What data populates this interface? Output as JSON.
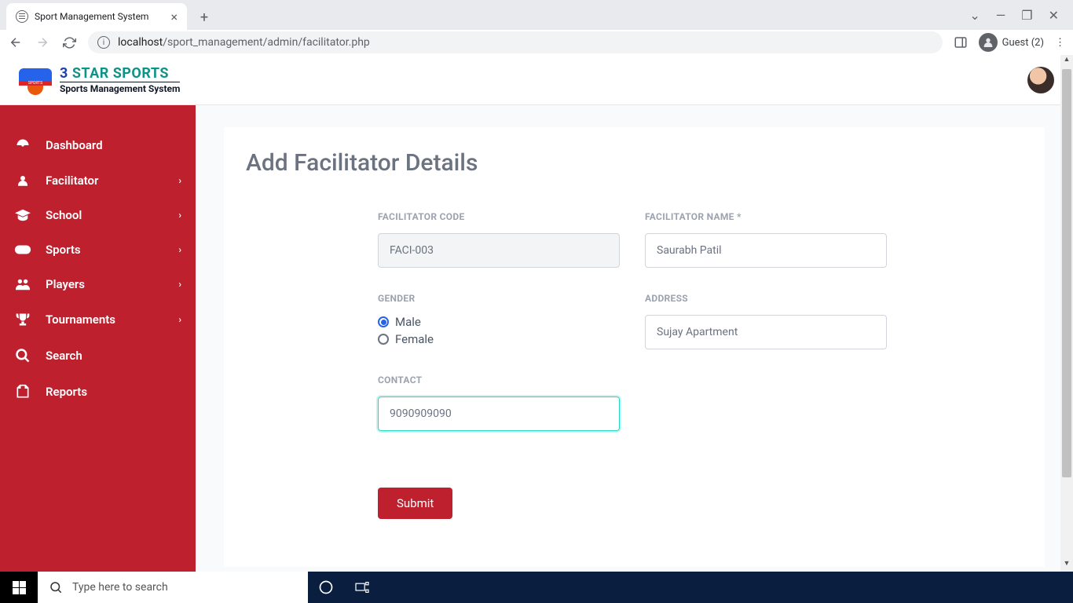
{
  "browser": {
    "tab_title": "Sport Management System",
    "url_host": "localhost",
    "url_path": "/sport_management/admin/facilitator.php",
    "guest_label": "Guest (2)"
  },
  "header": {
    "logo_line1_a": "3 ",
    "logo_line1_b": "STAR ",
    "logo_line1_c": "SPORTS",
    "logo_line2": "Sports Management System"
  },
  "sidebar": {
    "items": [
      {
        "label": "Dashboard",
        "icon": "dashboard",
        "expandable": false
      },
      {
        "label": "Facilitator",
        "icon": "user",
        "expandable": true
      },
      {
        "label": "School",
        "icon": "grad-cap",
        "expandable": true
      },
      {
        "label": "Sports",
        "icon": "gamepad",
        "expandable": true
      },
      {
        "label": "Players",
        "icon": "users",
        "expandable": true
      },
      {
        "label": "Tournaments",
        "icon": "trophy",
        "expandable": true
      },
      {
        "label": "Search",
        "icon": "search",
        "expandable": false
      },
      {
        "label": "Reports",
        "icon": "reports",
        "expandable": false
      }
    ]
  },
  "page": {
    "title": "Add Facilitator Details",
    "fields": {
      "code_label": "FACILITATOR CODE",
      "code_value": "FACI-003",
      "name_label": "FACILITATOR NAME *",
      "name_value": "Saurabh Patil",
      "gender_label": "GENDER",
      "gender_male": "Male",
      "gender_female": "Female",
      "gender_selected": "Male",
      "address_label": "ADDRESS",
      "address_value": "Sujay Apartment",
      "contact_label": "CONTACT",
      "contact_value": "9090909090"
    },
    "submit_label": "Submit"
  },
  "taskbar": {
    "search_placeholder": "Type here to search"
  }
}
